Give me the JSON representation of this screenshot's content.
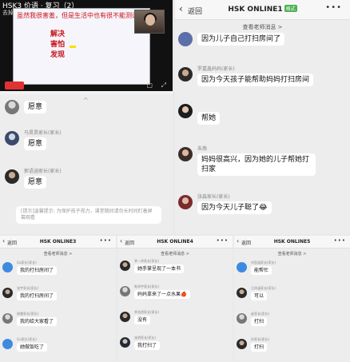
{
  "video": {
    "title": "HSK3 价语 · 复习（2）",
    "subtitle": "去掉",
    "slide_headline": "虽然我很害羞，但是生活中也有很不能测试的问题",
    "slide_words": [
      "解决",
      "害怕",
      "发现"
    ]
  },
  "classroom_chat": {
    "collapse_icon": "^",
    "messages": [
      {
        "sender": "",
        "text": "愿意"
      },
      {
        "sender": "马昊昊家长(家长)",
        "text": "愿意"
      },
      {
        "sender": "郭语涵家长(家长)",
        "text": "愿意"
      }
    ],
    "notice": "[提示]温馨提示: 为保护孩子视力，课堂期间请勿长时间盯着屏幕观看"
  },
  "panel_top": {
    "back_label": "返回",
    "title": "HSK ONLINE1",
    "badge": "格式",
    "more_icon": "•••",
    "view_all": "查看老师消息 >",
    "messages": [
      {
        "sender": "",
        "text": "因为儿子自己打扫房间了"
      },
      {
        "sender": "罗嘉鑫妈妈(家长)",
        "text": "因为今天孩子能帮助妈妈打扫房间"
      },
      {
        "sender": "",
        "text": "帮她"
      },
      {
        "sender": "朱燕",
        "text": "妈妈很高兴，因为她的儿子帮她打扫家"
      },
      {
        "sender": "张淼家长(家长)",
        "text": "因为今天儿子聪了",
        "emoji": "😂"
      }
    ]
  },
  "panel_b1": {
    "back_label": "返回",
    "title": "HSK ONLINE3",
    "more_icon": "•••",
    "view_all": "查看老师消息 >",
    "messages": [
      {
        "sender": "Ga家长(家长)",
        "text": "我的打扫房间了"
      },
      {
        "sender": "张宇家长(家长)",
        "text": "我的打扫房间了"
      },
      {
        "sender": "周睿家长(家长)",
        "text": "我的给大家看了"
      },
      {
        "sender": "Gu家长(家长)",
        "text": "她做饭吃了"
      }
    ]
  },
  "panel_b2": {
    "back_label": "返回",
    "title": "HSK ONLINE4",
    "more_icon": "•••",
    "view_all": "查看老师消息 >",
    "messages": [
      {
        "sender": "李一泽家长(家长)",
        "text": "她手掌呈现了一本书"
      },
      {
        "sender": "陈泽宇家长(家长)",
        "text": "妈妈拿来了一点水果",
        "emoji": "🍎"
      },
      {
        "sender": "李浩然家长(家长)",
        "text": "没有"
      },
      {
        "sender": "张明家长(家长)",
        "text": "我打扫了"
      }
    ]
  },
  "panel_b3": {
    "back_label": "返回",
    "title": "HSK ONLINE5",
    "more_icon": "•••",
    "view_all": "查看老师消息 >",
    "messages": [
      {
        "sender": "刘思涵家长(家长)",
        "text": "能帮忙"
      },
      {
        "sender": "王梓涵家长(家长)",
        "text": "可以"
      },
      {
        "sender": "赵家长(家长)",
        "text": "打扫"
      },
      {
        "sender": "孙家长(家长)",
        "text": "打扫"
      }
    ]
  }
}
